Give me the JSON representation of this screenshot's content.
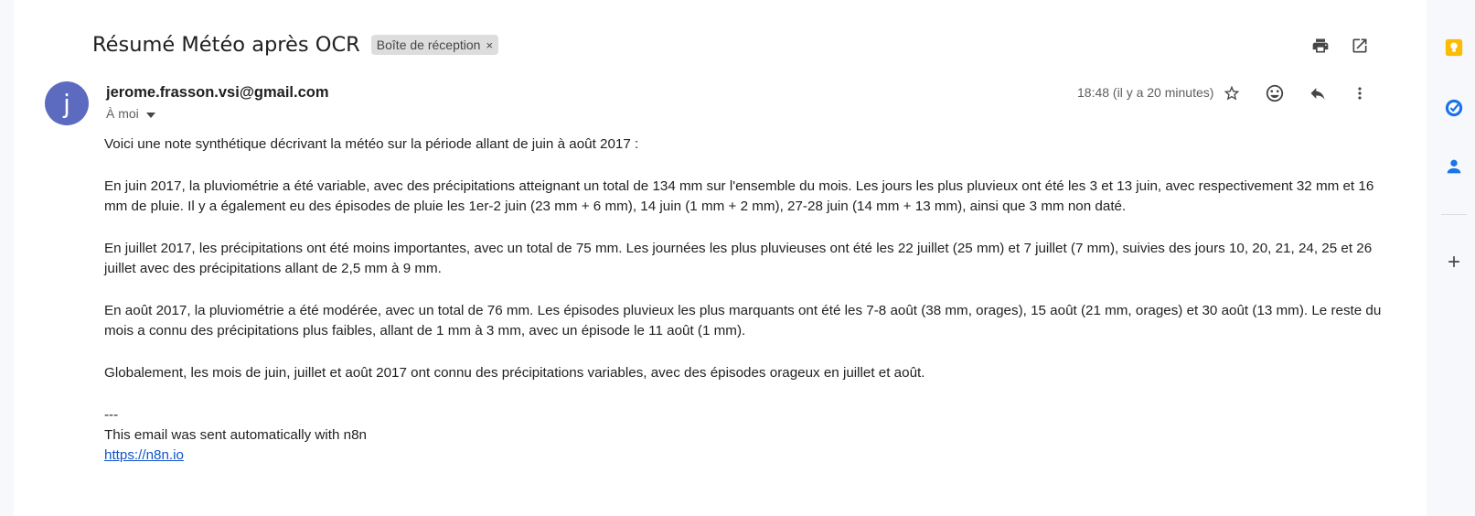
{
  "email": {
    "subject": "Résumé Météo après OCR",
    "label": "Boîte de réception",
    "label_remove": "×",
    "avatar_letter": "j",
    "sender": "jerome.frasson.vsi@gmail.com",
    "recipient": "À moi",
    "timestamp": "18:48 (il y a 20 minutes)",
    "body": [
      "Voici une note synthétique décrivant la météo sur la période allant de juin à août 2017 :",
      "En juin 2017, la pluviométrie a été variable, avec des précipitations atteignant un total de 134 mm sur l'ensemble du mois. Les jours les plus pluvieux ont été les 3 et 13 juin, avec respectivement 32 mm et 16 mm de pluie. Il y a également eu des épisodes de pluie les 1er-2 juin (23 mm + 6 mm), 14 juin (1 mm + 2 mm), 27-28 juin (14 mm + 13 mm), ainsi que 3 mm non daté.",
      "En juillet 2017, les précipitations ont été moins importantes, avec un total de 75 mm. Les journées les plus pluvieuses ont été les 22 juillet (25 mm) et 7 juillet (7 mm), suivies des jours 10, 20, 21, 24, 25 et 26 juillet avec des précipitations allant de 2,5 mm à 9 mm.",
      "En août 2017, la pluviométrie a été modérée, avec un total de 76 mm. Les épisodes pluvieux les plus marquants ont été les 7-8 août (38 mm, orages), 15 août (21 mm, orages) et 30 août (13 mm). Le reste du mois a connu des précipitations plus faibles, allant de 1 mm à 3 mm, avec un épisode le 11 août (1 mm).",
      "Globalement, les mois de juin, juillet et août 2017 ont connu des précipitations variables, avec des épisodes orageux en juillet et août."
    ],
    "signature": {
      "separator": "---",
      "line": "This email was sent automatically with n8n",
      "link": "https://n8n.io"
    }
  },
  "icons": {
    "print": "print-icon",
    "open_new_window": "open-in-new-window-icon",
    "star": "star-icon",
    "emoji": "emoji-reaction-icon",
    "reply": "reply-icon",
    "more": "more-vert-icon",
    "keep": "keep-icon",
    "tasks": "tasks-icon",
    "contacts": "contacts-icon",
    "add": "add-icon"
  },
  "colors": {
    "avatar": "#5c6bc0",
    "link": "#1155cc",
    "keep": "#fbbc04",
    "tasks": "#1a73e8",
    "contacts": "#1a73e8"
  }
}
